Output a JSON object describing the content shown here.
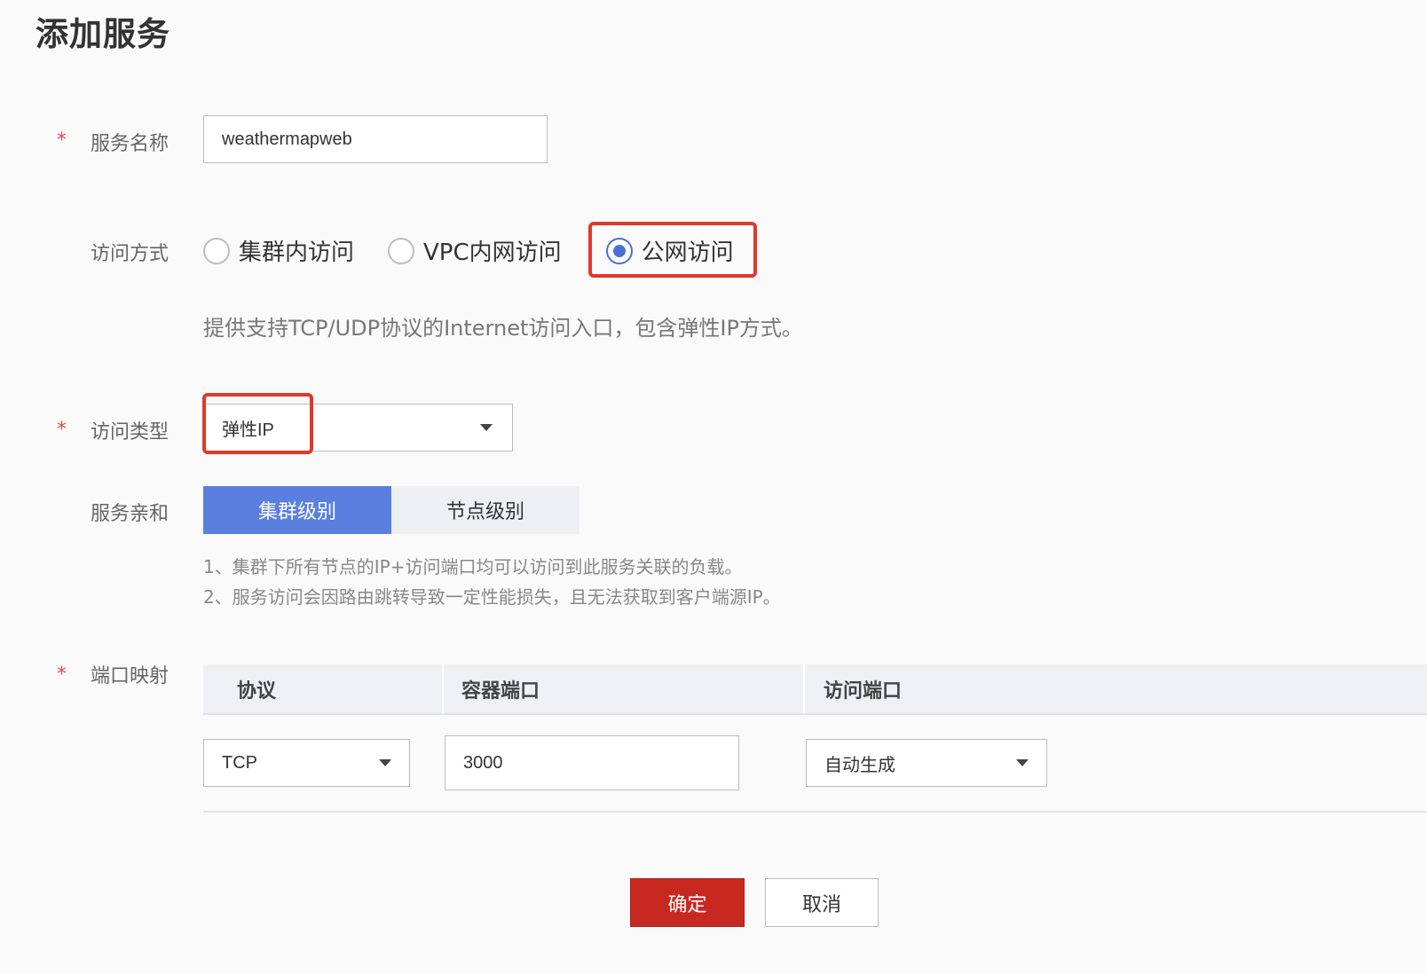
{
  "page": {
    "title": "添加服务"
  },
  "form": {
    "service_name": {
      "label": "服务名称",
      "value": "weathermapweb"
    },
    "access_mode": {
      "label": "访问方式",
      "options": [
        {
          "label": "集群内访问",
          "selected": false
        },
        {
          "label": "VPC内网访问",
          "selected": false
        },
        {
          "label": "公网访问",
          "selected": true
        }
      ],
      "hint": "提供支持TCP/UDP协议的Internet访问入口，包含弹性IP方式。"
    },
    "access_type": {
      "label": "访问类型",
      "value": "弹性IP"
    },
    "service_affinity": {
      "label": "服务亲和",
      "options": [
        {
          "label": "集群级别",
          "active": true
        },
        {
          "label": "节点级别",
          "active": false
        }
      ],
      "notes": [
        "1、集群下所有节点的IP+访问端口均可以访问到此服务关联的负载。",
        "2、服务访问会因路由跳转导致一定性能损失，且无法获取到客户端源IP。"
      ]
    },
    "port_mapping": {
      "label": "端口映射",
      "columns": [
        "协议",
        "容器端口",
        "访问端口"
      ],
      "rows": [
        {
          "protocol": "TCP",
          "container_port": "3000",
          "access_port": "自动生成"
        }
      ]
    }
  },
  "actions": {
    "confirm": "确定",
    "cancel": "取消"
  },
  "colors": {
    "accent": "#5a7fdf",
    "primary_button": "#c7281f",
    "highlight": "#e0382b",
    "required": "#e5484d"
  }
}
